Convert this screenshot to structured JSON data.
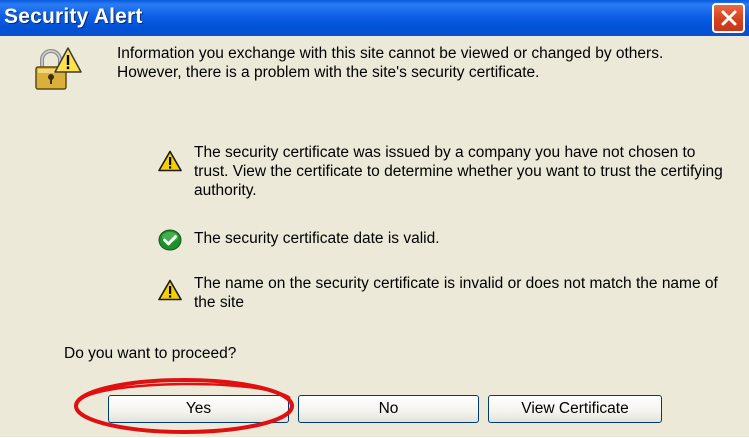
{
  "window": {
    "title": "Security Alert"
  },
  "message": {
    "intro": "Information you exchange with this site cannot be viewed or changed by others. However, there is a problem with the site's security certificate."
  },
  "items": [
    {
      "icon": "warning-icon",
      "text": "The security certificate was issued by a company you have not chosen to trust. View the certificate to determine whether you want to trust the certifying authority."
    },
    {
      "icon": "check-icon",
      "text": "The security certificate date is valid."
    },
    {
      "icon": "warning-icon",
      "text": "The name on the security certificate is invalid or does not match the name of the site"
    }
  ],
  "prompt": "Do you want to proceed?",
  "buttons": {
    "yes": "Yes",
    "no": "No",
    "view_certificate": "View Certificate"
  },
  "colors": {
    "titlebar": "#0054e3",
    "dialog_bg": "#ece9d8",
    "close_button": "#d8431f",
    "highlight": "#e01010",
    "warning": "#f5d000",
    "check": "#1f8f2a"
  }
}
